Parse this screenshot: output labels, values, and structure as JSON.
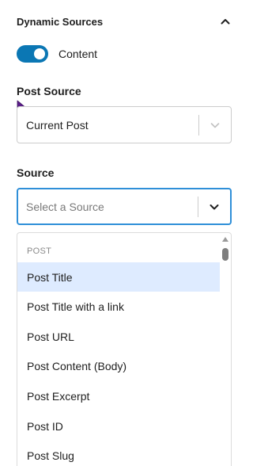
{
  "section": {
    "title": "Dynamic Sources",
    "collapse_icon": "chevron-up-icon"
  },
  "toggle": {
    "label": "Content",
    "state": "on",
    "color": "#0b77b4"
  },
  "post_source": {
    "label": "Post Source",
    "value": "Current Post",
    "arrow_icon": "chevron-down-icon"
  },
  "source": {
    "label": "Source",
    "placeholder": "Select a Source",
    "arrow_icon": "chevron-down-icon",
    "focus_color": "#2f8fd8"
  },
  "menu": {
    "group_heading": "POST",
    "highlight_color": "#deebff",
    "highlighted_index": 0,
    "options": [
      "Post Title",
      "Post Title with a link",
      "Post URL",
      "Post Content (Body)",
      "Post Excerpt",
      "Post ID",
      "Post Slug"
    ]
  }
}
